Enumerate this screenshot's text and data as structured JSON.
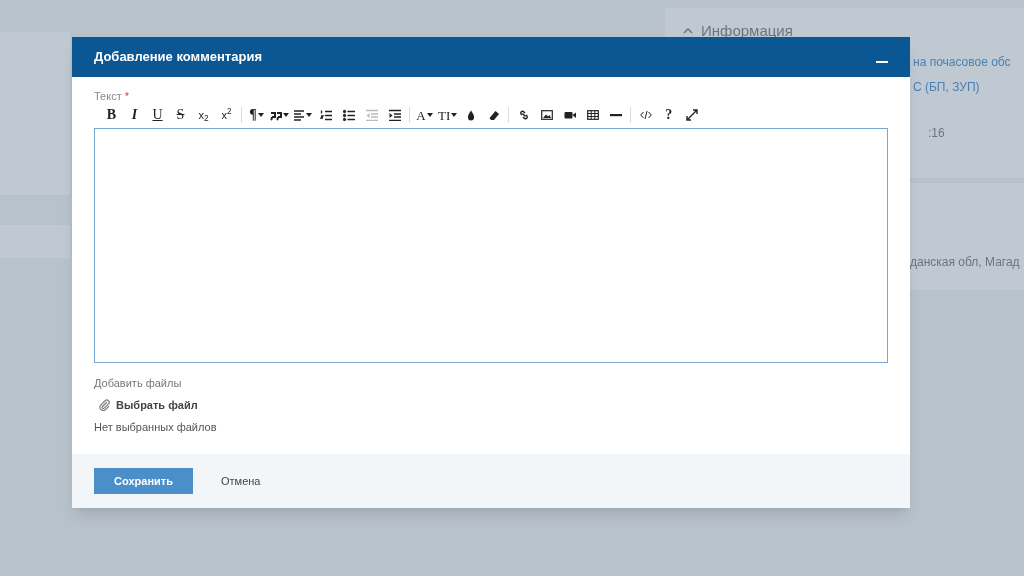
{
  "background": {
    "info_panel": {
      "title": "Информация",
      "lines": [
        {
          "text": "на почасовое обс",
          "link": true
        },
        {
          "text": "С (БП, ЗУП)",
          "link": true
        },
        {
          "text": ":16",
          "link": false
        }
      ]
    },
    "address_panel": {
      "lines": [
        {
          "text": "данская обл, Магад",
          "link": false
        }
      ]
    }
  },
  "dialog": {
    "title": "Добавление комментария",
    "field_label": "Текст",
    "required_mark": "*",
    "toolbar": [
      [
        {
          "kind": "bold",
          "label": "B",
          "dropdown": false,
          "disabled": false
        },
        {
          "kind": "italic",
          "label": "I",
          "dropdown": false,
          "disabled": false
        },
        {
          "kind": "underline",
          "label": "U",
          "dropdown": false,
          "disabled": false
        },
        {
          "kind": "strike",
          "label": "S",
          "dropdown": false,
          "disabled": false
        },
        {
          "kind": "script",
          "label": "x$_{2}$",
          "dropdown": false,
          "disabled": false
        },
        {
          "kind": "script",
          "label": "x$^{2}$",
          "dropdown": false,
          "disabled": false
        }
      ],
      [
        {
          "kind": "bold",
          "label": "¶",
          "dropdown": true,
          "disabled": false
        },
        {
          "kind": "quote",
          "dropdown": true,
          "disabled": false
        },
        {
          "kind": "align",
          "dropdown": true,
          "disabled": false
        },
        {
          "kind": "ordered",
          "dropdown": false,
          "disabled": false
        },
        {
          "kind": "bullets",
          "dropdown": false,
          "disabled": false
        },
        {
          "kind": "outdent",
          "dropdown": false,
          "disabled": true
        },
        {
          "kind": "indent",
          "dropdown": false,
          "disabled": false
        }
      ],
      [
        {
          "kind": "serif",
          "label": "A",
          "dropdown": true,
          "disabled": false
        },
        {
          "kind": "serif",
          "label": "TI",
          "dropdown": true,
          "disabled": false
        },
        {
          "kind": "drop",
          "dropdown": false,
          "disabled": false
        },
        {
          "kind": "eraser",
          "dropdown": false,
          "disabled": false
        }
      ],
      [
        {
          "kind": "link",
          "dropdown": false,
          "disabled": false
        },
        {
          "kind": "image",
          "dropdown": false,
          "disabled": false
        },
        {
          "kind": "video",
          "dropdown": false,
          "disabled": false
        },
        {
          "kind": "table",
          "dropdown": false,
          "disabled": false
        },
        {
          "kind": "rule",
          "dropdown": false,
          "disabled": false
        }
      ],
      [
        {
          "kind": "code",
          "dropdown": false,
          "disabled": false
        },
        {
          "kind": "bold",
          "label": "?",
          "dropdown": false,
          "disabled": false
        },
        {
          "kind": "expand",
          "dropdown": false,
          "disabled": false
        }
      ]
    ],
    "files_label": "Добавить файлы",
    "choose_file": "Выбрать файл",
    "no_files": "Нет выбранных файлов",
    "buttons": [
      {
        "label": "Сохранить",
        "kind": "primary"
      },
      {
        "label": "Отмена",
        "kind": "plain"
      }
    ]
  }
}
